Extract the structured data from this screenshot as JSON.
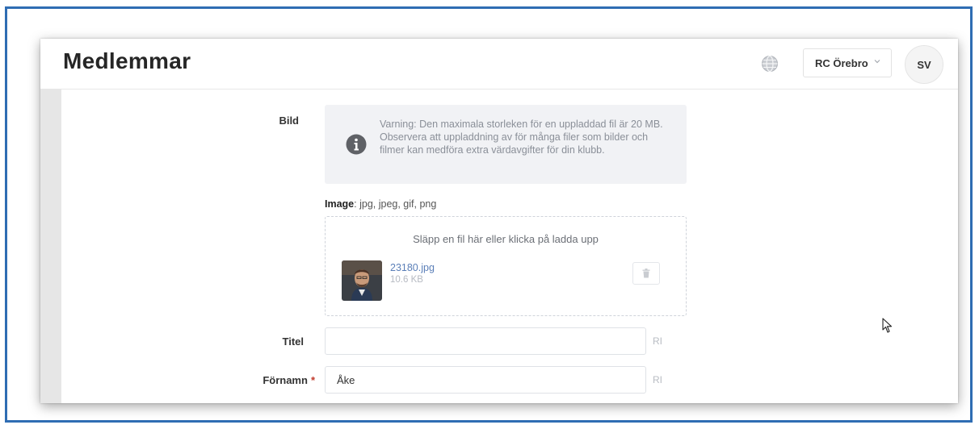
{
  "page": {
    "title": "Medlemmar"
  },
  "header": {
    "language_icon": "globe-icon",
    "club_select": {
      "value": "RC Örebro",
      "icon": "chevron-down-icon"
    },
    "avatar_initials": "SV"
  },
  "form": {
    "bild": {
      "label": "Bild",
      "warning_text": "Varning: Den maximala storleken för en uppladdad fil är 20 MB. Observera att uppladdning av för många filer som bilder och filmer kan medföra extra värdavgifter för din klubb.",
      "info_icon": "info-icon",
      "formats_label": "Image",
      "formats_value": ": jpg, jpeg, gif, png",
      "drop_hint": "Släpp en fil här eller klicka på ladda upp",
      "file": {
        "name": "23180.jpg",
        "size": "10.6 KB"
      },
      "delete_icon": "trash-icon"
    },
    "titel": {
      "label": "Titel",
      "value": "",
      "suffix": "RI"
    },
    "fornamn": {
      "label": "Förnamn",
      "required_mark": "*",
      "value": "Åke",
      "suffix": "RI"
    }
  },
  "colors": {
    "frame_border": "#2f6db3",
    "required": "#c0392b",
    "file_link": "#5b7fb8",
    "warning_bg": "#f1f2f5"
  }
}
